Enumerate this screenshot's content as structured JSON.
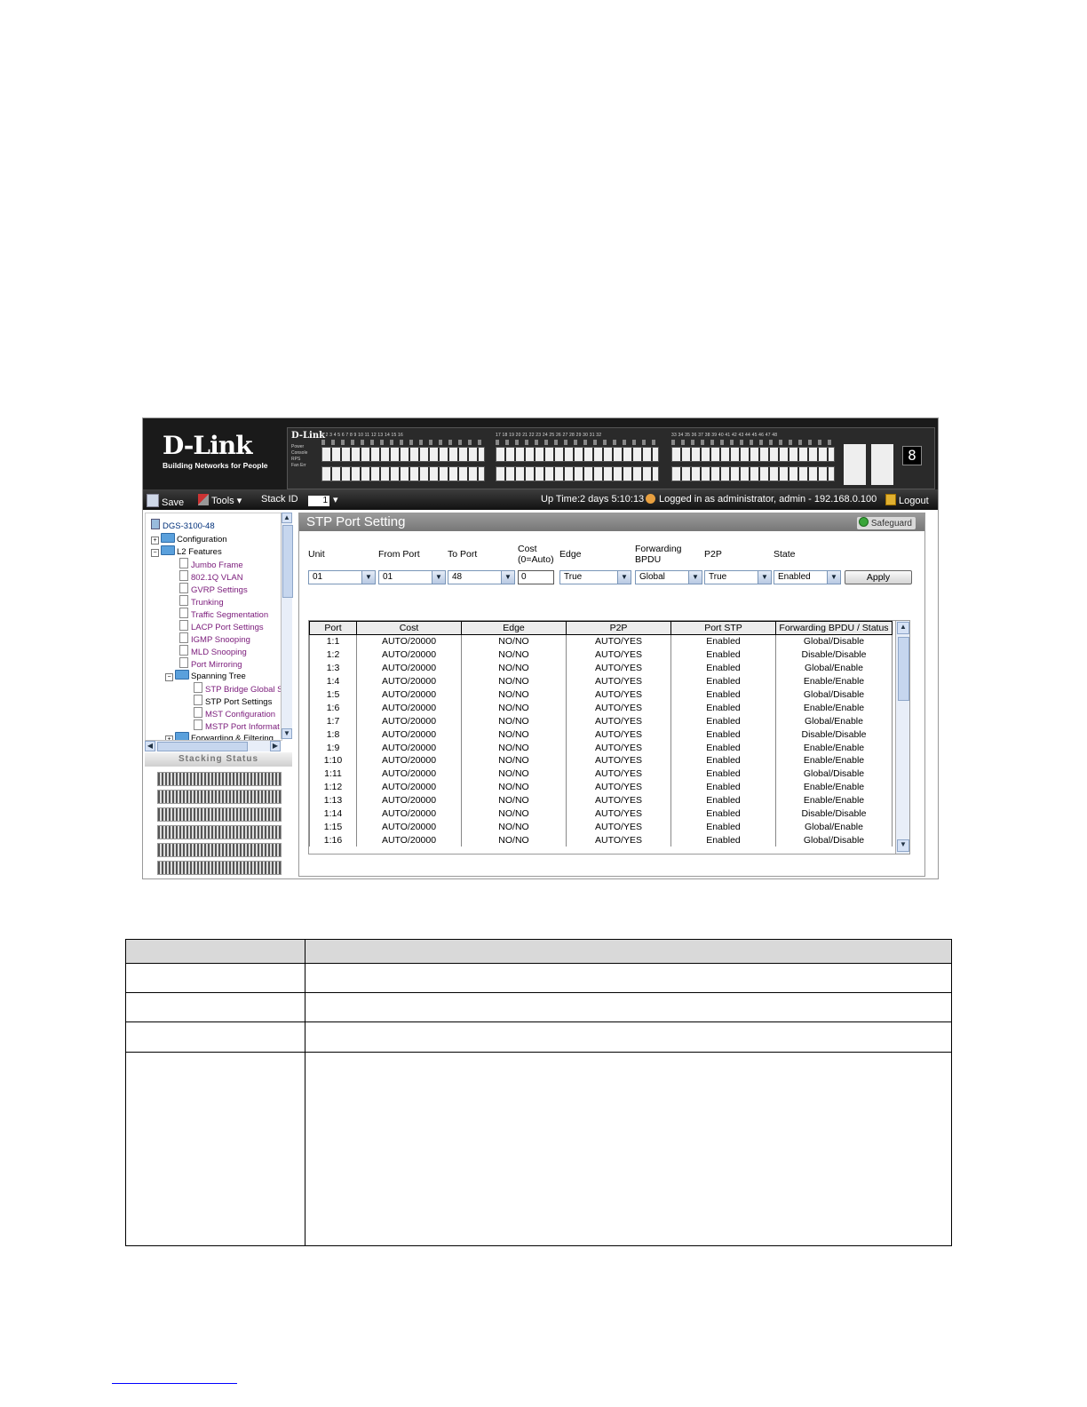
{
  "header": {
    "brand": "D-Link",
    "tagline": "Building Networks for People",
    "panel_brand": "D-Link",
    "panel_leds": [
      "Power",
      "Console",
      "RPS",
      "Fan Err"
    ],
    "port_numbers_g1": "1  2  3  4  5  6  7  8  9  10  11  12  13  14  15  16",
    "port_numbers_g2": "17  18  19  20  21  22  23  24  25  26  27  28  29  30  31  32",
    "port_numbers_g3": "33  34  35  36  37  38  39  40  41  42  43  44  45  46  47  48",
    "unit_digit": "8"
  },
  "toolbar": {
    "save_label": "Save",
    "tools_label": "Tools",
    "stack_id_label": "Stack ID",
    "stack_id_value": "1",
    "uptime": "Up Time:2 days 5:10:13",
    "login_info": "Logged in as administrator, admin - 192.168.0.100",
    "logout_label": "Logout"
  },
  "sidebar": {
    "items": [
      {
        "label": "DGS-3100-48"
      },
      {
        "label": "Configuration"
      },
      {
        "label": "L2 Features"
      },
      {
        "label": "Jumbo Frame"
      },
      {
        "label": "802.1Q VLAN"
      },
      {
        "label": "GVRP Settings"
      },
      {
        "label": "Trunking"
      },
      {
        "label": "Traffic Segmentation"
      },
      {
        "label": "LACP Port Settings"
      },
      {
        "label": "IGMP Snooping"
      },
      {
        "label": "MLD Snooping"
      },
      {
        "label": "Port Mirroring"
      },
      {
        "label": "Spanning Tree"
      },
      {
        "label": "STP Bridge Global S"
      },
      {
        "label": "STP Port Settings"
      },
      {
        "label": "MST Configuration"
      },
      {
        "label": "MSTP Port Informat"
      },
      {
        "label": "Forwarding & Filtering"
      }
    ],
    "stacking_status": "Stacking Status"
  },
  "main": {
    "title": "STP Port Setting",
    "safeguard": "Safeguard",
    "form": {
      "unit_label": "Unit",
      "from_port_label": "From Port",
      "to_port_label": "To Port",
      "cost_label_1": "Cost",
      "cost_label_2": "(0=Auto)",
      "edge_label": "Edge",
      "fwd_bpdu_label_1": "Forwarding",
      "fwd_bpdu_label_2": "BPDU",
      "p2p_label": "P2P",
      "state_label": "State",
      "unit_value": "01",
      "from_port_value": "01",
      "to_port_value": "48",
      "cost_value": "0",
      "edge_value": "True",
      "fwd_bpdu_value": "Global",
      "p2p_value": "True",
      "state_value": "Enabled",
      "apply_label": "Apply"
    },
    "table": {
      "headers": [
        "Port",
        "Cost",
        "Edge",
        "P2P",
        "Port STP",
        "Forwarding BPDU / Status"
      ],
      "rows": [
        [
          "1:1",
          "AUTO/20000",
          "NO/NO",
          "AUTO/YES",
          "Enabled",
          "Global/Disable"
        ],
        [
          "1:2",
          "AUTO/20000",
          "NO/NO",
          "AUTO/YES",
          "Enabled",
          "Disable/Disable"
        ],
        [
          "1:3",
          "AUTO/20000",
          "NO/NO",
          "AUTO/YES",
          "Enabled",
          "Global/Enable"
        ],
        [
          "1:4",
          "AUTO/20000",
          "NO/NO",
          "AUTO/YES",
          "Enabled",
          "Enable/Enable"
        ],
        [
          "1:5",
          "AUTO/20000",
          "NO/NO",
          "AUTO/YES",
          "Enabled",
          "Global/Disable"
        ],
        [
          "1:6",
          "AUTO/20000",
          "NO/NO",
          "AUTO/YES",
          "Enabled",
          "Enable/Enable"
        ],
        [
          "1:7",
          "AUTO/20000",
          "NO/NO",
          "AUTO/YES",
          "Enabled",
          "Global/Enable"
        ],
        [
          "1:8",
          "AUTO/20000",
          "NO/NO",
          "AUTO/YES",
          "Enabled",
          "Disable/Disable"
        ],
        [
          "1:9",
          "AUTO/20000",
          "NO/NO",
          "AUTO/YES",
          "Enabled",
          "Enable/Enable"
        ],
        [
          "1:10",
          "AUTO/20000",
          "NO/NO",
          "AUTO/YES",
          "Enabled",
          "Enable/Enable"
        ],
        [
          "1:11",
          "AUTO/20000",
          "NO/NO",
          "AUTO/YES",
          "Enabled",
          "Global/Disable"
        ],
        [
          "1:12",
          "AUTO/20000",
          "NO/NO",
          "AUTO/YES",
          "Enabled",
          "Enable/Enable"
        ],
        [
          "1:13",
          "AUTO/20000",
          "NO/NO",
          "AUTO/YES",
          "Enabled",
          "Enable/Enable"
        ],
        [
          "1:14",
          "AUTO/20000",
          "NO/NO",
          "AUTO/YES",
          "Enabled",
          "Disable/Disable"
        ],
        [
          "1:15",
          "AUTO/20000",
          "NO/NO",
          "AUTO/YES",
          "Enabled",
          "Global/Enable"
        ],
        [
          "1:16",
          "AUTO/20000",
          "NO/NO",
          "AUTO/YES",
          "Enabled",
          "Global/Disable"
        ]
      ]
    }
  },
  "colors": {
    "selected_tree_item": "#1d5bbf",
    "title_bar": "#888888",
    "safeguard_green": "#3aa53a"
  }
}
